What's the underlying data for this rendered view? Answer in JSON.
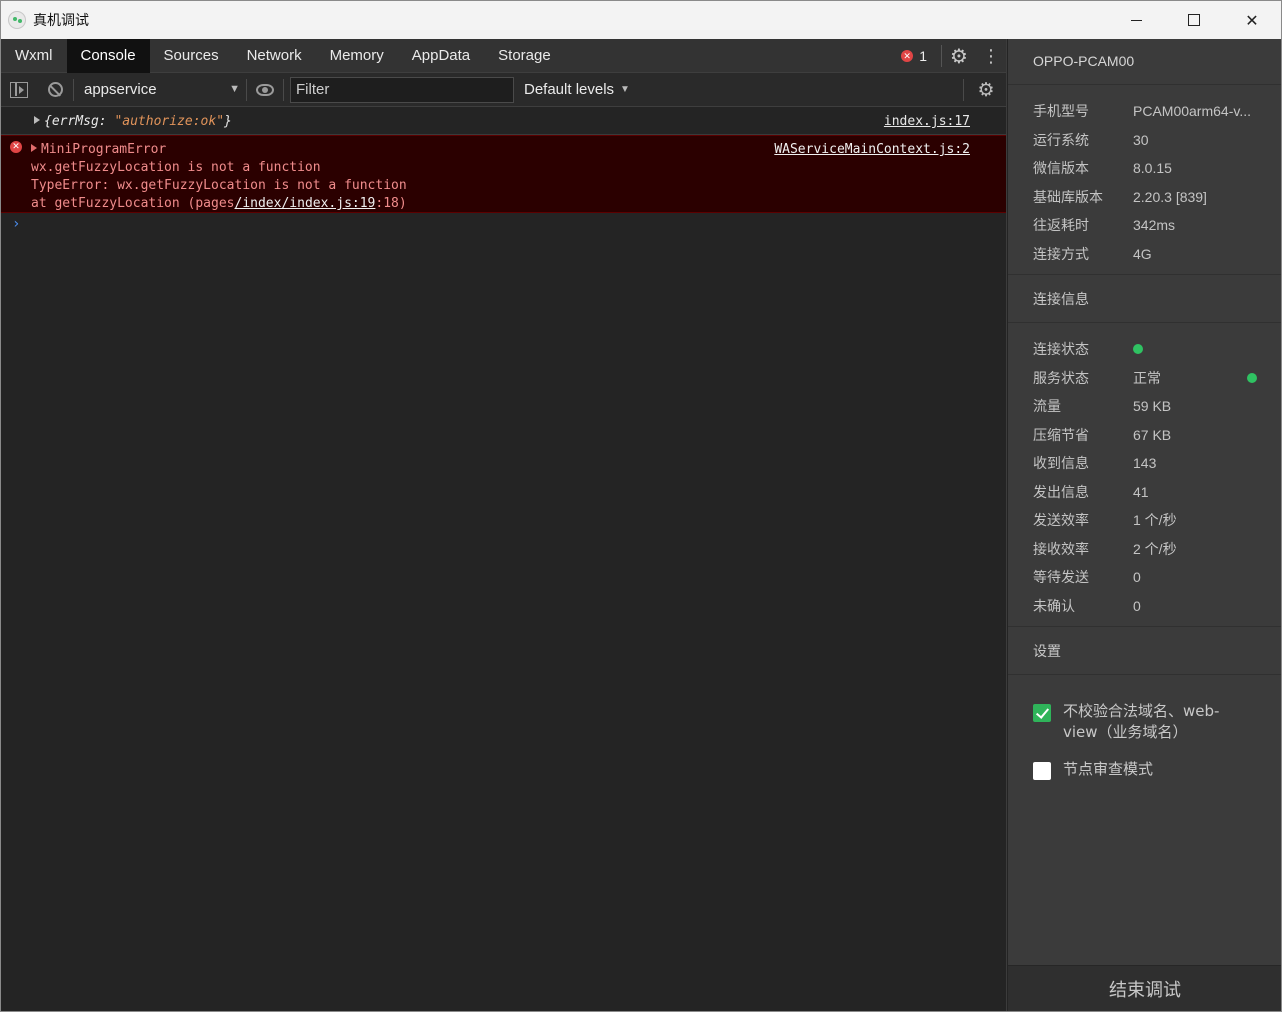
{
  "window": {
    "title": "真机调试"
  },
  "tabs": [
    "Wxml",
    "Console",
    "Sources",
    "Network",
    "Memory",
    "AppData",
    "Storage"
  ],
  "active_tab": "Console",
  "error_count": "1",
  "toolbar": {
    "context": "appservice",
    "filter_placeholder": "Filter",
    "levels": "Default levels"
  },
  "console": {
    "log1": {
      "brace_open": "{",
      "key": "errMsg:",
      "value": "\"authorize:ok\"",
      "brace_close": "}",
      "source": "index.js:17"
    },
    "error1": {
      "title": "MiniProgramError",
      "line1": "wx.getFuzzyLocation is not a function",
      "line2": "TypeError: wx.getFuzzyLocation is not a function",
      "line3_prefix": "at getFuzzyLocation (pages",
      "line3_link": "/index/index.js:19",
      "line3_suffix": ":18)",
      "source": "WAServiceMainContext.js:2"
    },
    "prompt": "›"
  },
  "panel": {
    "device": "OPPO-PCAM00",
    "info": [
      {
        "label": "手机型号",
        "value": "PCAM00arm64-v..."
      },
      {
        "label": "运行系统",
        "value": "30"
      },
      {
        "label": "微信版本",
        "value": "8.0.15"
      },
      {
        "label": "基础库版本",
        "value": "2.20.3 [839]"
      },
      {
        "label": "往返耗时",
        "value": "342ms"
      },
      {
        "label": "连接方式",
        "value": "4G"
      }
    ],
    "conn_title": "连接信息",
    "conn": [
      {
        "label": "连接状态",
        "value": ""
      },
      {
        "label": "服务状态",
        "value": "正常"
      },
      {
        "label": "流量",
        "value": "59 KB"
      },
      {
        "label": "压缩节省",
        "value": "67 KB"
      },
      {
        "label": "收到信息",
        "value": "143"
      },
      {
        "label": "发出信息",
        "value": "41"
      },
      {
        "label": "发送效率",
        "value": "1 个/秒"
      },
      {
        "label": "接收效率",
        "value": "2 个/秒"
      },
      {
        "label": "等待发送",
        "value": "0"
      },
      {
        "label": "未确认",
        "value": "0"
      }
    ],
    "settings_title": "设置",
    "settings": [
      {
        "label": "不校验合法域名、web-view（业务域名）",
        "checked": true
      },
      {
        "label": "节点审查模式",
        "checked": false
      }
    ],
    "end_button": "结束调试"
  },
  "colors": {
    "status_ok": "#2fc262",
    "error": "#e04545",
    "checkbox_on": "#2fb45a"
  }
}
